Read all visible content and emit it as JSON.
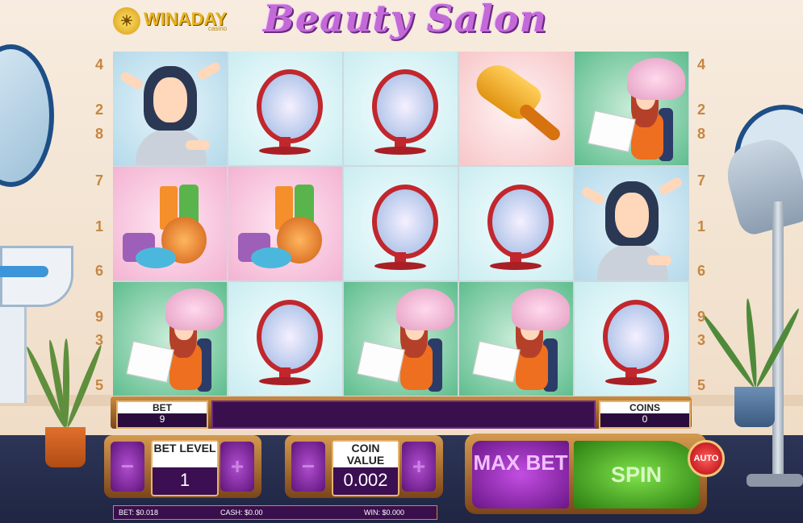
{
  "brand": {
    "logo_text": "WINADAY",
    "logo_sub": "casino",
    "game_title": "Beauty Salon"
  },
  "paylines": {
    "left": [
      "4",
      "2",
      "8",
      "7",
      "1",
      "6",
      "9",
      "3",
      "5"
    ],
    "right": [
      "4",
      "2",
      "8",
      "7",
      "1",
      "6",
      "9",
      "3",
      "5"
    ]
  },
  "reels": [
    [
      "lady",
      "mirror",
      "mirror",
      "brush",
      "dryer-lady"
    ],
    [
      "cosmetics",
      "cosmetics",
      "mirror",
      "mirror",
      "lady"
    ],
    [
      "dryer-lady",
      "mirror",
      "dryer-lady",
      "dryer-lady",
      "mirror"
    ]
  ],
  "status": {
    "bet_label": "BET",
    "bet_value": "9",
    "coins_label": "COINS",
    "coins_value": "0"
  },
  "controls": {
    "bet_level": {
      "label": "BET LEVEL",
      "value": "1",
      "minus": "−",
      "plus": "+"
    },
    "coin_value": {
      "label": "COIN VALUE",
      "value": "0.002",
      "minus": "−",
      "plus": "+"
    },
    "max_bet": "MAX BET",
    "spin": "SPIN",
    "auto": "AUTO"
  },
  "info": {
    "bet": "BET: $0.018",
    "cash": "CASH: $0.00",
    "win": "WIN: $0.000"
  },
  "colors": {
    "accent_purple": "#8a2aa8",
    "spin_green": "#3fa31c",
    "frame_bronze": "#c98b3e"
  }
}
